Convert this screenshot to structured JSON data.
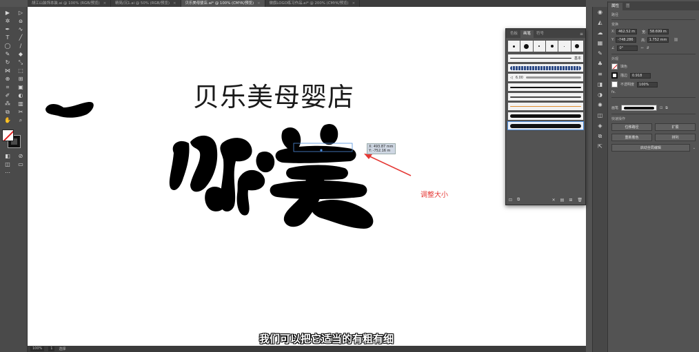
{
  "colors": {
    "accent_red": "#e53935",
    "selection": "#4f8edc",
    "canvas": "#ffffff",
    "chrome": "#535353"
  },
  "tabs": [
    {
      "label": "胡江山装饰本装.ai @ 100% (RGB/预览)",
      "active": false
    },
    {
      "label": "精简/沉1.ai @ 50% (RGB/预览)",
      "active": false
    },
    {
      "label": "贝乐美母婴店.ai* @ 100% (CMYK/预览)",
      "active": true
    },
    {
      "label": "做旗LOGO练习作品.ai* @ 200% (CMYK/预览)",
      "active": false
    }
  ],
  "tab_close_glyph": "×",
  "canvas": {
    "title": "贝乐美母婴店",
    "readout": "X: 493.87 mm\nY: -752.16 m",
    "annotation": "调整大小"
  },
  "subtitle": "我们可以把它适当的有粗有细",
  "statusbar": {
    "zoom": "100%",
    "artboard": "1",
    "tool": "选择"
  },
  "brush_panel": {
    "tabs": [
      "色板",
      "画笔",
      "符号"
    ],
    "menu": "≡",
    "basic_label": "基本",
    "size_label": "6.00"
  },
  "properties": {
    "tabs": [
      "属性",
      "图"
    ],
    "section_path": "路径",
    "section_transform": "变换",
    "x_label": "X:",
    "x_value": "462.52 m",
    "w_label": "宽:",
    "w_value": "58.699 m",
    "y_label": "Y:",
    "y_value": "-748.286",
    "h_label": "高:",
    "h_value": "1.752 mm",
    "angle_value": "0°",
    "section_appearance": "外观",
    "fill_label": "填色",
    "stroke_label": "描边",
    "stroke_value": "0.918",
    "opacity_label": "不透明度",
    "opacity_value": "100%",
    "fx_label": "fx.",
    "brush_label": "画笔",
    "section_quick": "快速操作",
    "btn_offset": "位移路径",
    "btn_expand": "扩展",
    "btn_recolor": "重新着色",
    "btn_arrange": "排列",
    "btn_global_edit": "启动全局编辑"
  }
}
